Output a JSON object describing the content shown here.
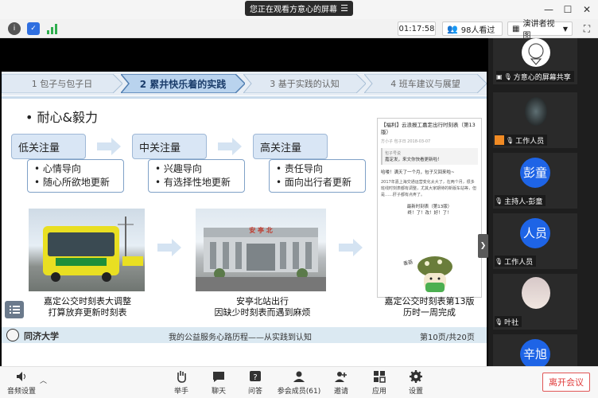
{
  "window": {
    "share_banner": "您正在观看方意心的屏幕",
    "share_banner_icon": "list-icon"
  },
  "toolbar": {
    "timer": "01:17:58",
    "viewer_count": "98人看过",
    "view_mode": "演讲者视图"
  },
  "slide": {
    "tabs": [
      {
        "label": "1 包子与包子日",
        "active": false
      },
      {
        "label": "2 累井快乐着的实践",
        "active": true
      },
      {
        "label": "3 基于实践的认知",
        "active": false
      },
      {
        "label": "4 班车建议与展望",
        "active": false
      }
    ],
    "subtitle": "• 耐心&毅力",
    "levels": [
      {
        "title": "低关注量",
        "lines": [
          "• 心情导向",
          "• 随心所欲地更新"
        ]
      },
      {
        "title": "中关注量",
        "lines": [
          "• 兴趣导向",
          "• 有选择性地更新"
        ]
      },
      {
        "title": "高关注量",
        "lines": [
          "• 责任导向",
          "• 面向出行者更新"
        ]
      }
    ],
    "captions": [
      {
        "line1": "嘉定公交时刻表大调整",
        "line2": "打算放弃更新时刻表"
      },
      {
        "line1": "安亭北站出行",
        "line2": "因缺少时刻表而遇到麻烦"
      },
      {
        "line1": "嘉定公交时刻表第13版",
        "line2": "历时一周完成"
      }
    ],
    "station_sign": "安 亭 北",
    "article": {
      "title": "【福利】云浪报工嘉定出行时刻表（第13版）",
      "meta": "方小子  包子日   2018-03-07",
      "quote_head": "包子号说",
      "quote_body": "嘉定发，来文你快看更新啦！",
      "greeting": "哈喽！满天了一个月，包子又回来啦~",
      "body": "2017年嘉上海交通运营变化太大了，在两个月，很多班线时刻表都有调整，尤其大家期待的新版车站等，但是……肝子都有点疼了。",
      "center1": "最新时刻表（第13版）",
      "center2": "终！了！改！好！了！",
      "badge": "香菇"
    },
    "footer_left": "同济大学",
    "footer_center": "我的公益服务心路历程——从实践到认知",
    "footer_right": "第10页/共20页"
  },
  "participants": [
    {
      "name": "方意心的屏幕共享",
      "avatar": "",
      "kind": "share"
    },
    {
      "name": "工作人员",
      "avatar": "",
      "kind": "photo"
    },
    {
      "name": "主持人-彭童",
      "avatar": "彭童",
      "kind": "avatar"
    },
    {
      "name": "工作人员",
      "avatar": "人员",
      "kind": "avatar"
    },
    {
      "name": "叶社",
      "avatar": "",
      "kind": "photo2"
    },
    {
      "name": "",
      "avatar": "辛旭",
      "kind": "avatar"
    }
  ],
  "bottom_bar": {
    "audio": "音频设置",
    "items": [
      "举手",
      "聊天",
      "问答",
      "参会成员(61)",
      "邀请",
      "应用",
      "设置"
    ],
    "leave": "离开会议"
  },
  "colors": {
    "accent": "#1e64e6",
    "leave": "#e03c3c",
    "tab_active": "#2d5b94"
  }
}
